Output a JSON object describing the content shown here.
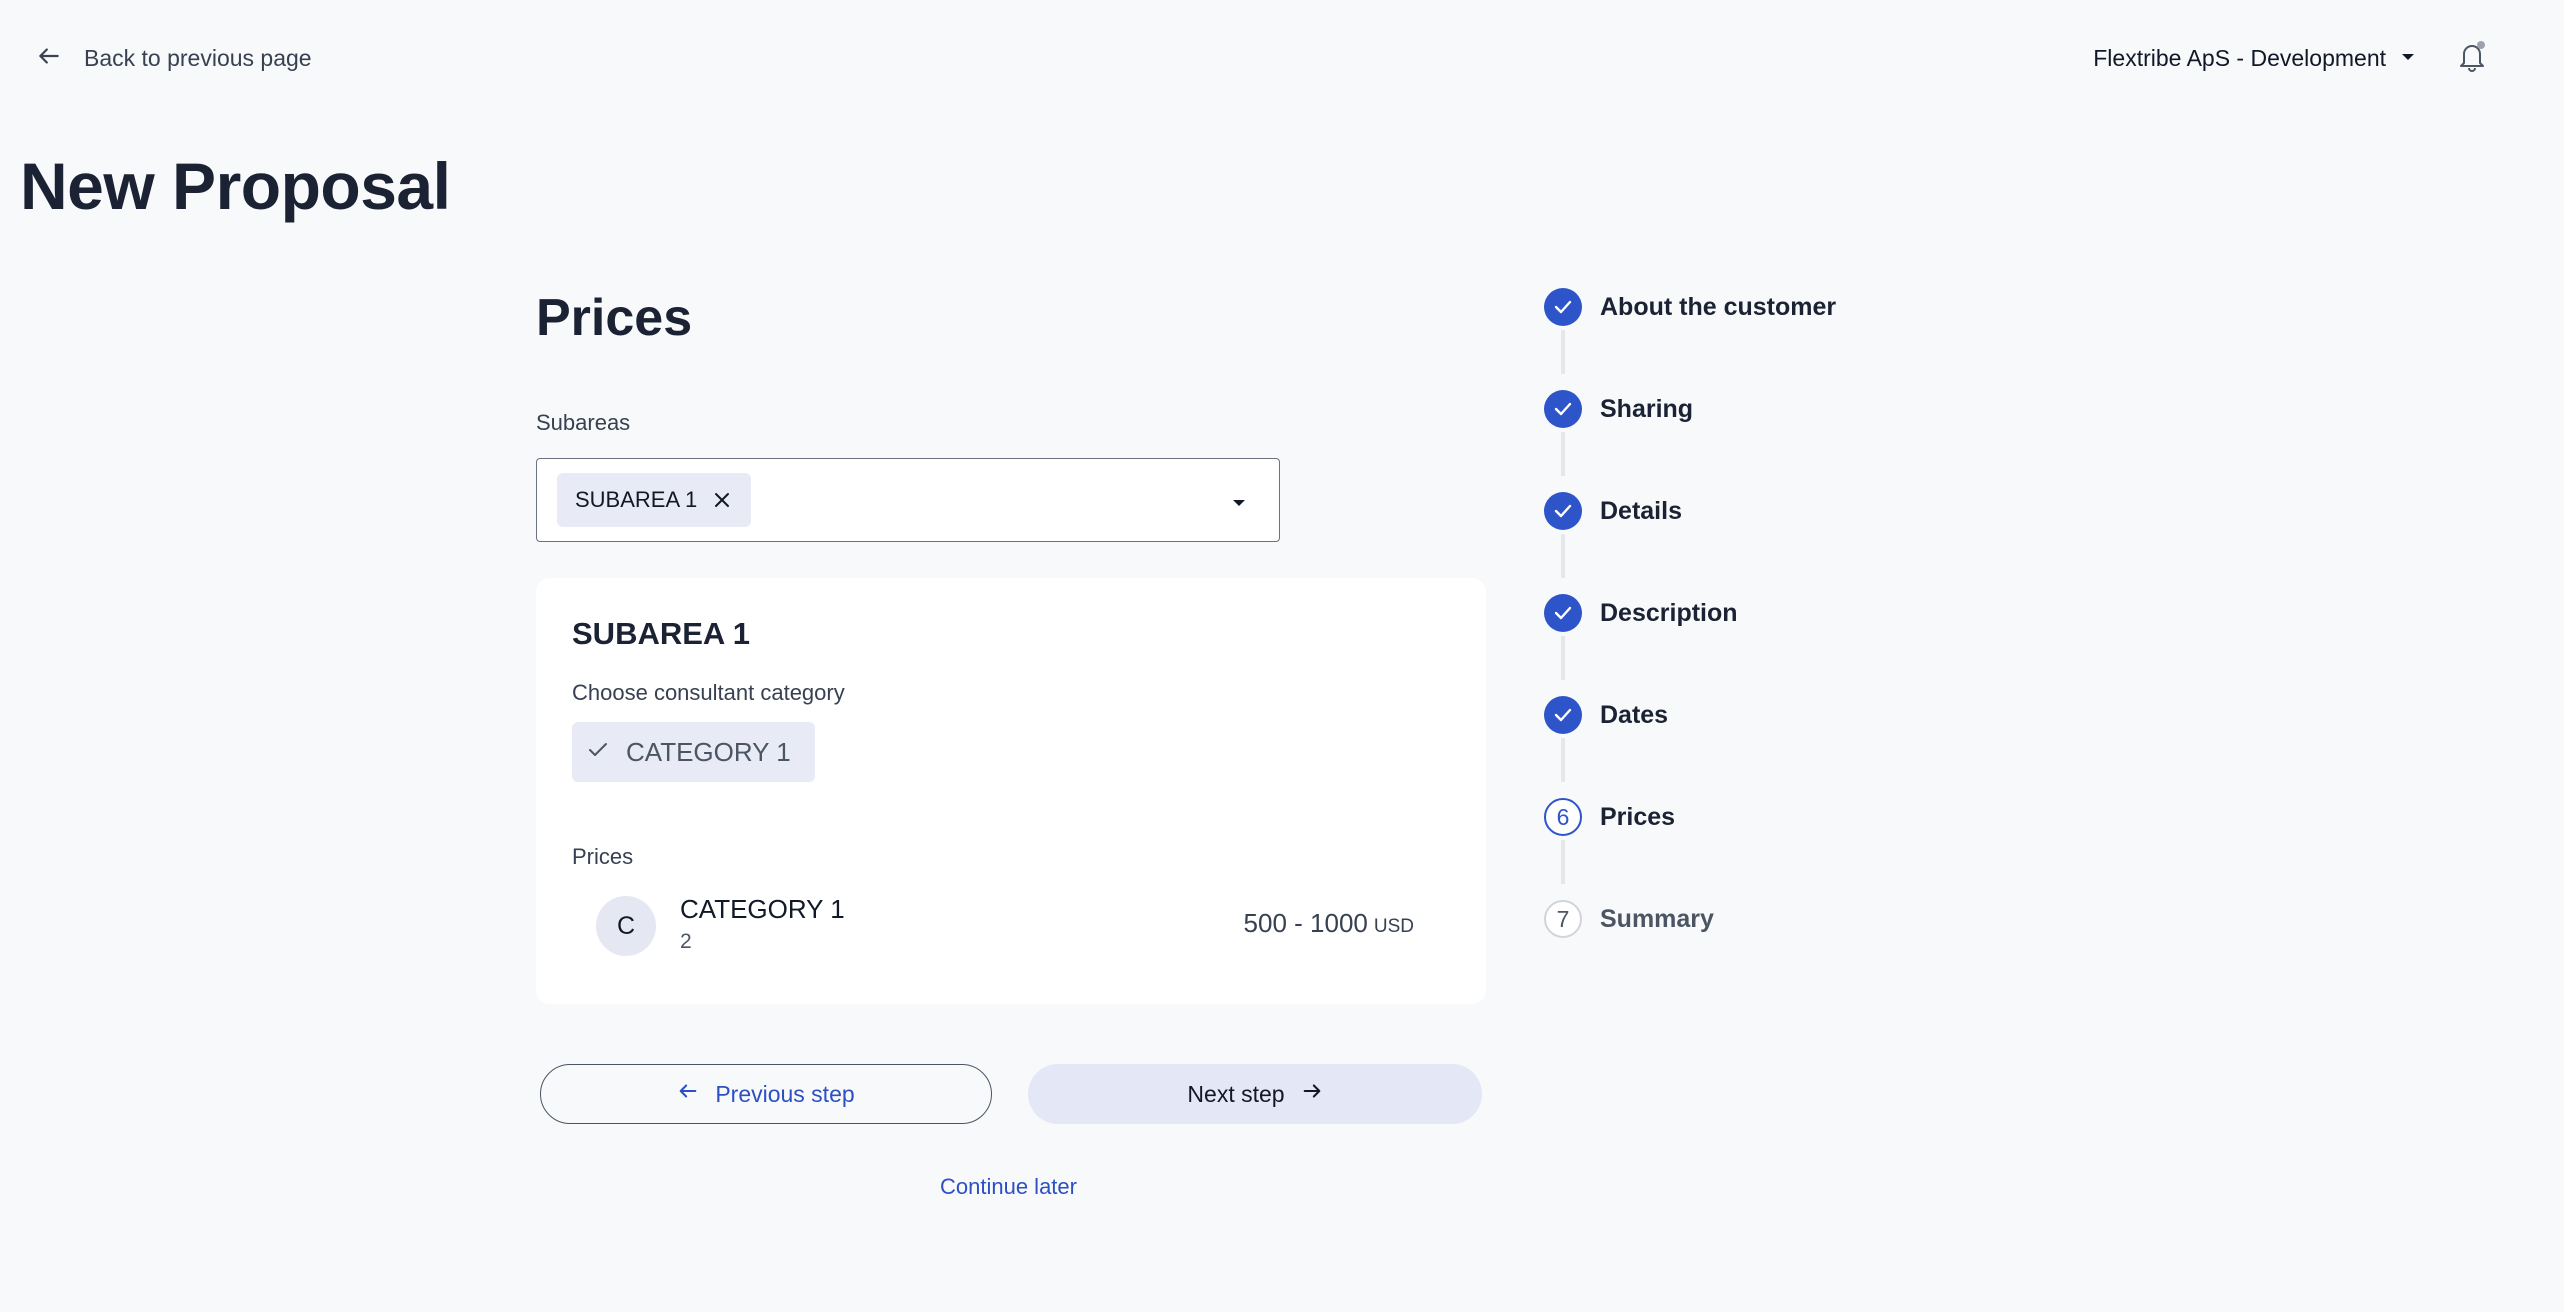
{
  "header": {
    "back_label": "Back to previous page",
    "org_name": "Flextribe ApS - Development"
  },
  "page_title": "New Proposal",
  "form": {
    "section_title": "Prices",
    "subareas_label": "Subareas",
    "selected_subarea": "SUBAREA 1"
  },
  "card": {
    "title": "SUBAREA 1",
    "category_prompt": "Choose consultant category",
    "selected_category": "CATEGORY 1",
    "prices_label": "Prices",
    "price_row": {
      "avatar_letter": "C",
      "name": "CATEGORY 1",
      "count": "2",
      "range": "500 - 1000",
      "currency": "USD"
    }
  },
  "actions": {
    "previous_label": "Previous step",
    "next_label": "Next step",
    "continue_label": "Continue later"
  },
  "stepper": {
    "steps": [
      {
        "label": "About the customer",
        "status": "done"
      },
      {
        "label": "Sharing",
        "status": "done"
      },
      {
        "label": "Details",
        "status": "done"
      },
      {
        "label": "Description",
        "status": "done"
      },
      {
        "label": "Dates",
        "status": "done"
      },
      {
        "label": "Prices",
        "status": "current",
        "number": "6"
      },
      {
        "label": "Summary",
        "status": "pending",
        "number": "7"
      }
    ]
  },
  "colors": {
    "accent": "#2d55c9",
    "link": "#2d4fc4",
    "chip_bg": "#e8ebf5",
    "page_bg": "#f8f9fa"
  },
  "icons": {
    "back": "arrow-left-icon",
    "org_dropdown": "caret-down-icon",
    "notifications": "bell-icon",
    "chip_remove": "close-icon",
    "select_dropdown": "caret-down-icon",
    "category_selected": "check-icon",
    "prev": "arrow-left-icon",
    "next": "arrow-right-icon",
    "step_done": "check-icon"
  }
}
